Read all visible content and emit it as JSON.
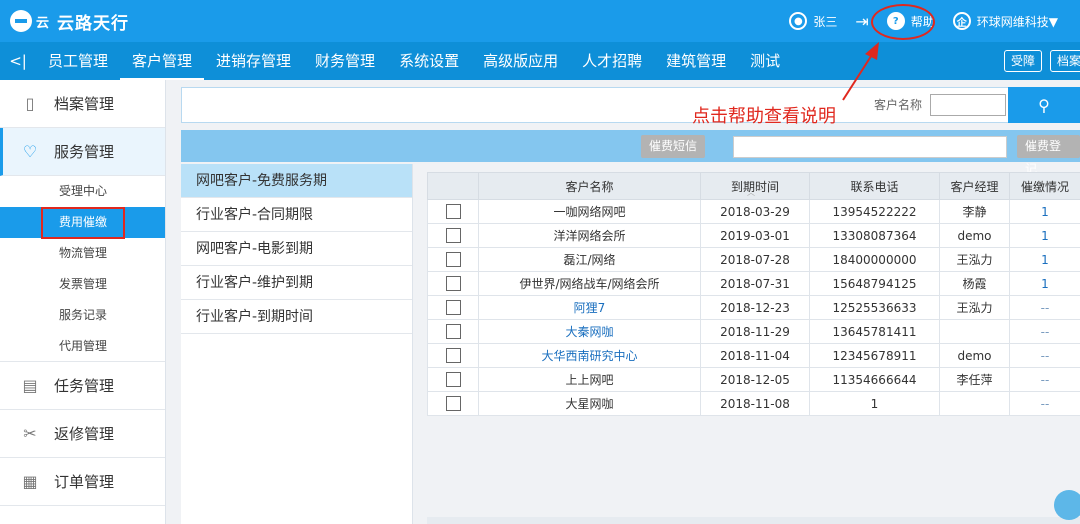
{
  "app": {
    "logo_text": "云路天行",
    "logo_sub": "云"
  },
  "top": {
    "user": "张三",
    "help": "帮助",
    "company": "环球网维科技▼"
  },
  "nav": {
    "collapse": "<|",
    "items": [
      "员工管理",
      "客户管理",
      "进销存管理",
      "财务管理",
      "系统设置",
      "高级版应用",
      "人才招聘",
      "建筑管理",
      "测试"
    ],
    "active_index": 1,
    "btns": [
      "受障",
      "档案"
    ]
  },
  "sidebar": {
    "groups": [
      {
        "label": "档案管理",
        "icon": "folder-icon"
      },
      {
        "label": "服务管理",
        "icon": "heart-icon"
      }
    ],
    "subs": [
      "受理中心",
      "费用催缴",
      "物流管理",
      "发票管理",
      "服务记录",
      "代用管理"
    ],
    "active_sub": 1,
    "groups2": [
      {
        "label": "任务管理",
        "icon": "clipboard-icon"
      },
      {
        "label": "返修管理",
        "icon": "tools-icon"
      },
      {
        "label": "订单管理",
        "icon": "order-icon"
      }
    ]
  },
  "search": {
    "label": "客户名称",
    "value": ""
  },
  "annotation": "点击帮助查看说明",
  "actions": {
    "sms": "催费短信",
    "register": "催费登记",
    "input_value": ""
  },
  "categories": [
    "网吧客户-免费服务期",
    "行业客户-合同期限",
    "网吧客户-电影到期",
    "行业客户-维护到期",
    "行业客户-到期时间"
  ],
  "table": {
    "columns": [
      "",
      "客户名称",
      "到期时间",
      "联系电话",
      "客户经理",
      "催缴情况"
    ],
    "rows": [
      {
        "name": "一咖网络网吧",
        "date": "2018-03-29",
        "phone": "13954522222",
        "manager": "李静",
        "status": "1",
        "link": false
      },
      {
        "name": "洋洋网络会所",
        "date": "2019-03-01",
        "phone": "13308087364",
        "manager": "demo",
        "status": "1",
        "link": false
      },
      {
        "name": "磊江/网络",
        "date": "2018-07-28",
        "phone": "18400000000",
        "manager": "王泓力",
        "status": "1",
        "link": false
      },
      {
        "name": "伊世界/网络战车/网络会所",
        "date": "2018-07-31",
        "phone": "15648794125",
        "manager": "杨霞",
        "status": "1",
        "link": false
      },
      {
        "name": "阿狸7",
        "date": "2018-12-23",
        "phone": "12525536633",
        "manager": "王泓力",
        "status": "--",
        "link": true
      },
      {
        "name": "大秦网咖",
        "date": "2018-11-29",
        "phone": "13645781411",
        "manager": "",
        "status": "--",
        "link": true
      },
      {
        "name": "大华西南研究中心",
        "date": "2018-11-04",
        "phone": "12345678911",
        "manager": "demo",
        "status": "--",
        "link": true
      },
      {
        "name": "上上网吧",
        "date": "2018-12-05",
        "phone": "11354666644",
        "manager": "李任萍",
        "status": "--",
        "link": false
      },
      {
        "name": "大星网咖",
        "date": "2018-11-08",
        "phone": "1",
        "manager": "",
        "status": "--",
        "link": false
      }
    ]
  },
  "colors": {
    "primary": "#1a9bea",
    "nav": "#0e8fd8",
    "highlight": "#e0281e",
    "link": "#1a6fbf"
  }
}
